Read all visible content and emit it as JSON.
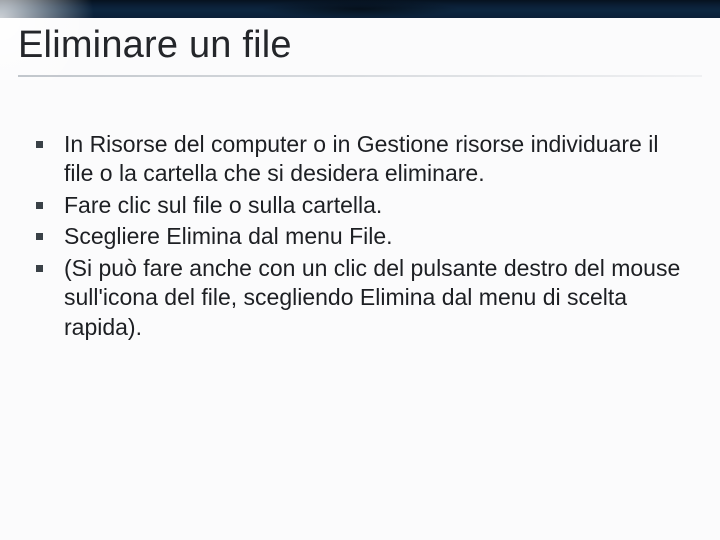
{
  "title": "Eliminare un file",
  "bullets": [
    "In Risorse del computer o in Gestione risorse individuare il file o la cartella che si desidera eliminare.",
    "Fare clic sul file o sulla cartella.",
    "Scegliere Elimina dal menu File.",
    "(Si può fare anche con un clic del pulsante destro del mouse sull'icona del file, scegliendo Elimina dal menu di scelta rapida)."
  ]
}
